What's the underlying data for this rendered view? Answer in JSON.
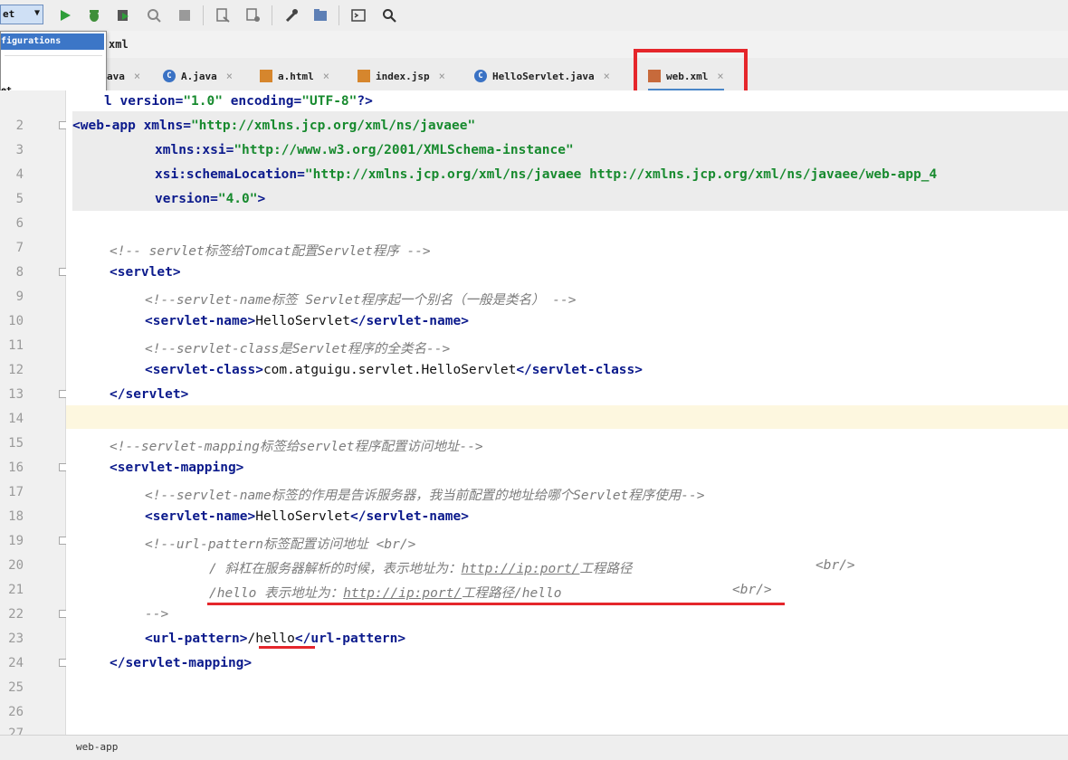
{
  "toolbar": {
    "run_config_label": "et",
    "icons": [
      "run-icon",
      "debug-icon",
      "coverage-icon",
      "profile-icon",
      "stop-icon",
      "build-icon",
      "sync-icon",
      "settings-wrench-icon",
      "project-structure-icon",
      "terminal-icon",
      "search-icon"
    ]
  },
  "run_config_popup": {
    "item_1": "figurations",
    "item_2": "et"
  },
  "navbar": {
    "label": "xml"
  },
  "tabs": [
    {
      "label": "ava",
      "icon": "java-class-icon"
    },
    {
      "label": "A.java",
      "icon": "java-class-icon"
    },
    {
      "label": "a.html",
      "icon": "html-file-icon"
    },
    {
      "label": "index.jsp",
      "icon": "jsp-file-icon"
    },
    {
      "label": "HelloServlet.java",
      "icon": "java-class-icon"
    },
    {
      "label": "web.xml",
      "icon": "xml-file-icon",
      "active": true
    }
  ],
  "close_glyph": "×",
  "editor": {
    "line_numbers": [
      "2",
      "3",
      "4",
      "5",
      "6",
      "7",
      "8",
      "9",
      "10",
      "11",
      "12",
      "13",
      "14",
      "15",
      "16",
      "17",
      "18",
      "19",
      "20",
      "21",
      "22",
      "23",
      "24",
      "25",
      "26",
      "27"
    ],
    "l1_a": "l version=",
    "l1_v1": "\"1.0\"",
    "l1_b": " encoding=",
    "l1_v2": "\"UTF-8\"",
    "l1_c": "?>",
    "l2_tag": "<web-app",
    "l2_attr": " xmlns=",
    "l2_val": "\"http://xmlns.jcp.org/xml/ns/javaee\"",
    "l3_attr": "xmlns:xsi=",
    "l3_val": "\"http://www.w3.org/2001/XMLSchema-instance\"",
    "l4_attr": "xsi:schemaLocation=",
    "l4_val": "\"http://xmlns.jcp.org/xml/ns/javaee http://xmlns.jcp.org/xml/ns/javaee/web-app_4",
    "l5_attr": "version=",
    "l5_val": "\"4.0\"",
    "l5_end": ">",
    "l7": "<!-- servlet标签给Tomcat配置Servlet程序 -->",
    "l8": "<servlet>",
    "l9": "<!--servlet-name标签 Servlet程序起一个别名（一般是类名） -->",
    "l10_open": "<servlet-name>",
    "l10_text": "HelloServlet",
    "l10_close": "</servlet-name>",
    "l11": "<!--servlet-class是Servlet程序的全类名-->",
    "l12_open": "<servlet-class>",
    "l12_text": "com.atguigu.servlet.HelloServlet",
    "l12_close": "</servlet-class>",
    "l13": "</servlet>",
    "l15": "<!--servlet-mapping标签给servlet程序配置访问地址-->",
    "l16": "<servlet-mapping>",
    "l17": "<!--servlet-name标签的作用是告诉服务器，我当前配置的地址给哪个Servlet程序使用-->",
    "l18_open": "<servlet-name>",
    "l18_text": "HelloServlet",
    "l18_close": "</servlet-name>",
    "l19": "<!--url-pattern标签配置访问地址 <br/>",
    "l20_a": "/ 斜杠在服务器解析的时候，表示地址为：",
    "l20_link": "http://ip:port/",
    "l20_b": "工程路径",
    "l20_br": "<br/>",
    "l21_a": "/hello 表示地址为：",
    "l21_link": "http://ip:port/",
    "l21_b": "工程路径/hello",
    "l21_br": "<br/>",
    "l22": "-->",
    "l23_open": "<url-pattern>",
    "l23_text": "/hello",
    "l23_close": "</url-pattern>",
    "l24": "</servlet-mapping>"
  },
  "status_bar": {
    "breadcrumb": "web-app"
  },
  "colors": {
    "annotation": "#e5262b",
    "tag": "#0b1a8c",
    "value": "#178a2e",
    "comment": "#7c7c7c",
    "selection": "#3c76c7"
  }
}
